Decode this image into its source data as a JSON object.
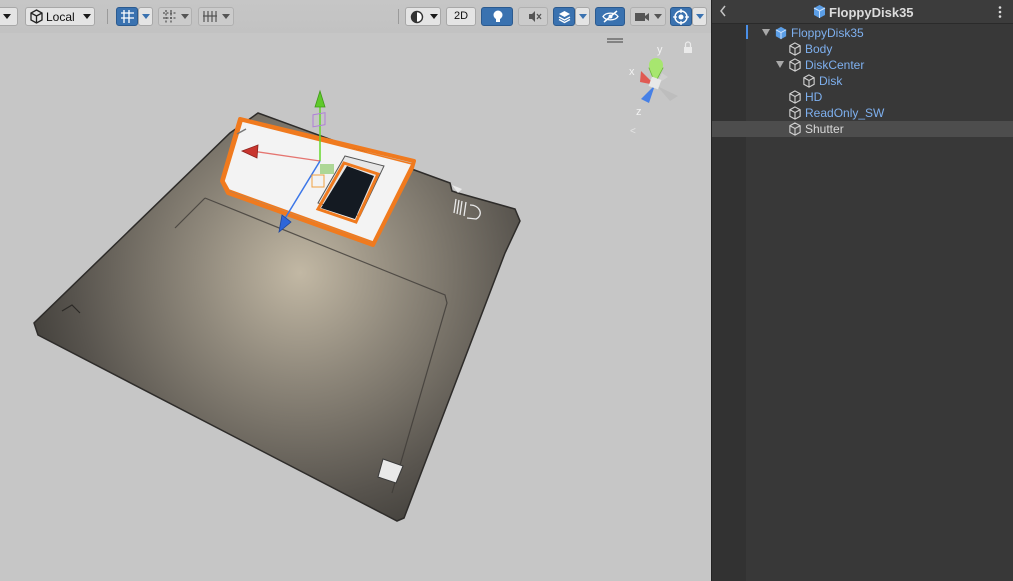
{
  "toolbar": {
    "pivot_rotation": "Local",
    "mode_2d": "2D"
  },
  "hierarchy": {
    "title": "FloppyDisk35",
    "items": [
      {
        "label": "FloppyDisk35",
        "depth": 0,
        "expanded": true,
        "icon": "prefab-cube-icon"
      },
      {
        "label": "Body",
        "depth": 1,
        "icon": "gameobject-cube-icon"
      },
      {
        "label": "DiskCenter",
        "depth": 1,
        "expanded": true,
        "icon": "gameobject-cube-icon"
      },
      {
        "label": "Disk",
        "depth": 2,
        "icon": "gameobject-cube-icon"
      },
      {
        "label": "HD",
        "depth": 1,
        "icon": "gameobject-cube-icon"
      },
      {
        "label": "ReadOnly_SW",
        "depth": 1,
        "icon": "gameobject-cube-icon"
      },
      {
        "label": "Shutter",
        "depth": 1,
        "selected": true,
        "icon": "gameobject-cube-icon"
      }
    ]
  },
  "gizmo": {
    "axis_y": "y",
    "axis_z": "z",
    "axis_x": "x"
  },
  "colors": {
    "selection_outline": "#f07a1e",
    "x_axis": "#e0413a",
    "y_axis": "#66d62b",
    "z_axis": "#3b76e8",
    "prefab_blue": "#7eb0ef"
  }
}
